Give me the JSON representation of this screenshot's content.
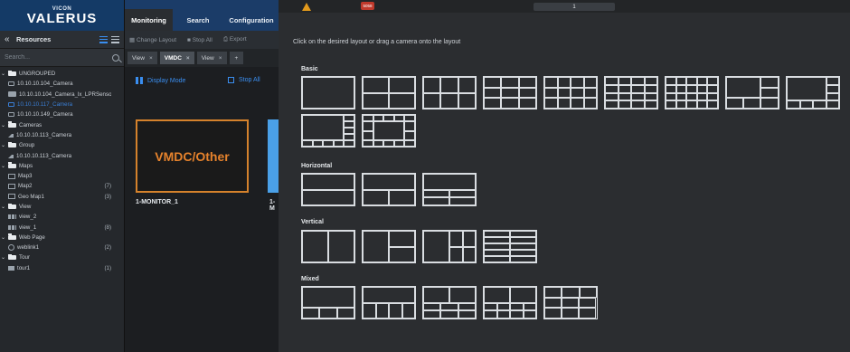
{
  "brand": {
    "sub": "VICON",
    "name": "VALERUS"
  },
  "top_tabs": [
    "Monitoring",
    "Search",
    "Configuration"
  ],
  "resources": {
    "title": "Resources",
    "search_placeholder": "Search..."
  },
  "tree": [
    {
      "label": "UNGROUPED",
      "icon": "folder-icon",
      "arrow": "v",
      "count": ""
    },
    {
      "label": "10.10.10.104_Camera",
      "icon": "camera-icon",
      "arrow": "",
      "count": ""
    },
    {
      "label": "10.10.10.104_Camera_lx_LPRSensor",
      "icon": "lpr-sensor-icon",
      "arrow": "",
      "count": ""
    },
    {
      "label": "10.10.10.117_Camera",
      "icon": "camera-icon",
      "arrow": "",
      "count": "",
      "selected": true
    },
    {
      "label": "10.10.10.149_Camera",
      "icon": "camera-icon",
      "arrow": "",
      "count": ""
    },
    {
      "label": "Cameras",
      "icon": "folder-icon",
      "arrow": "v",
      "count": ""
    },
    {
      "label": "10.10.10.113_Camera",
      "icon": "ptz-camera-icon",
      "arrow": "",
      "count": ""
    },
    {
      "label": "Group",
      "icon": "folder-icon",
      "arrow": "v",
      "count": ""
    },
    {
      "label": "10.10.10.113_Camera",
      "icon": "ptz-camera-icon",
      "arrow": "",
      "count": ""
    },
    {
      "label": "Maps",
      "icon": "folder-icon",
      "arrow": "v",
      "count": ""
    },
    {
      "label": "Map3",
      "icon": "map-icon",
      "arrow": "",
      "count": ""
    },
    {
      "label": "Map2",
      "icon": "map-icon",
      "arrow": "",
      "count": "(7)"
    },
    {
      "label": "Geo Map1",
      "icon": "map-icon",
      "arrow": "",
      "count": "(3)"
    },
    {
      "label": "View",
      "icon": "folder-icon",
      "arrow": "v",
      "count": ""
    },
    {
      "label": "view_2",
      "icon": "view-icon",
      "arrow": "",
      "count": ""
    },
    {
      "label": "view_1",
      "icon": "view-icon",
      "arrow": "",
      "count": "(8)"
    },
    {
      "label": "Web Page",
      "icon": "folder-icon",
      "arrow": "v",
      "count": ""
    },
    {
      "label": "weblink1",
      "icon": "globe-icon",
      "arrow": "",
      "count": "(2)"
    },
    {
      "label": "Tour",
      "icon": "folder-icon",
      "arrow": "v",
      "count": ""
    },
    {
      "label": "tour1",
      "icon": "tour-icon",
      "arrow": "",
      "count": "(1)"
    }
  ],
  "toolbar": {
    "change_layout": "Change Layout",
    "stop_all": "Stop All",
    "export": "Export"
  },
  "view_tabs": [
    {
      "label": "View",
      "active": false
    },
    {
      "label": "VMDC",
      "active": true
    },
    {
      "label": "View",
      "active": false
    }
  ],
  "viewer": {
    "display_mode": "Display Mode",
    "stop_all": "Stop All",
    "monitor_text": "VMDC/Other",
    "monitor_label": "1-MONITOR_1",
    "monitor2_label": "1-M"
  },
  "picker": {
    "alert_count": "5058",
    "page_number": "1",
    "instruction": "Click on the desired layout or drag a camera onto the layout",
    "sections": [
      "Basic",
      "Horizontal",
      "Vertical",
      "Mixed"
    ]
  },
  "colors": {
    "accent": "#3a8ef0",
    "brand": "#1b3c68",
    "monitor_border": "#d5822c",
    "warning": "#e39a1c"
  }
}
